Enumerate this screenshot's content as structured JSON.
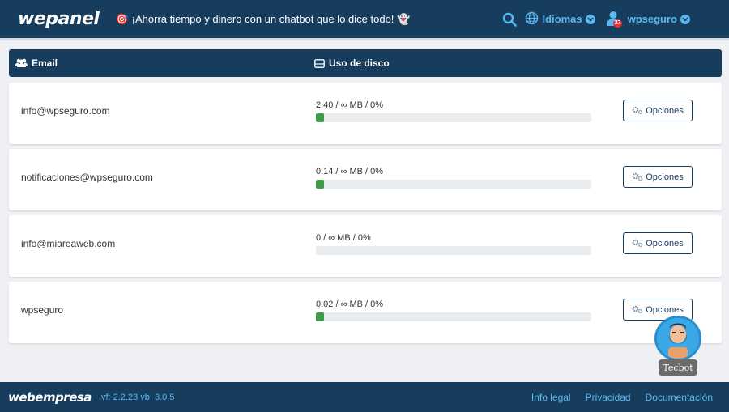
{
  "header": {
    "logo": "wepanel",
    "promo_text": "¡Ahorra tiempo y dinero con un chatbot que lo dice todo!",
    "languages_label": "Idiomas",
    "username": "wpseguro",
    "notification_count": "27"
  },
  "table": {
    "columns": {
      "email": "Email",
      "disk": "Uso de disco"
    },
    "rows": [
      {
        "email": "info@wpseguro.com",
        "usage": "2.40 / ∞ MB / 0%",
        "fill_percent": 3,
        "options_label": "Opciones"
      },
      {
        "email": "notificaciones@wpseguro.com",
        "usage": "0.14 / ∞ MB / 0%",
        "fill_percent": 3,
        "options_label": "Opciones"
      },
      {
        "email": "info@miareaweb.com",
        "usage": "0 / ∞ MB / 0%",
        "fill_percent": 0,
        "options_label": "Opciones"
      },
      {
        "email": "wpseguro",
        "usage": "0.02 / ∞ MB / 0%",
        "fill_percent": 3,
        "options_label": "Opciones"
      }
    ]
  },
  "chatbot": {
    "label": "Tecbot"
  },
  "footer": {
    "logo": "webempresa",
    "version": "vf: 2.2.23 vb: 3.0.5",
    "links": [
      "Info legal",
      "Privacidad",
      "Documentación"
    ]
  },
  "colors": {
    "navy": "#173d5e",
    "accent": "#5ab8f0",
    "progress": "#3f9b45",
    "badge": "#e0303a"
  }
}
